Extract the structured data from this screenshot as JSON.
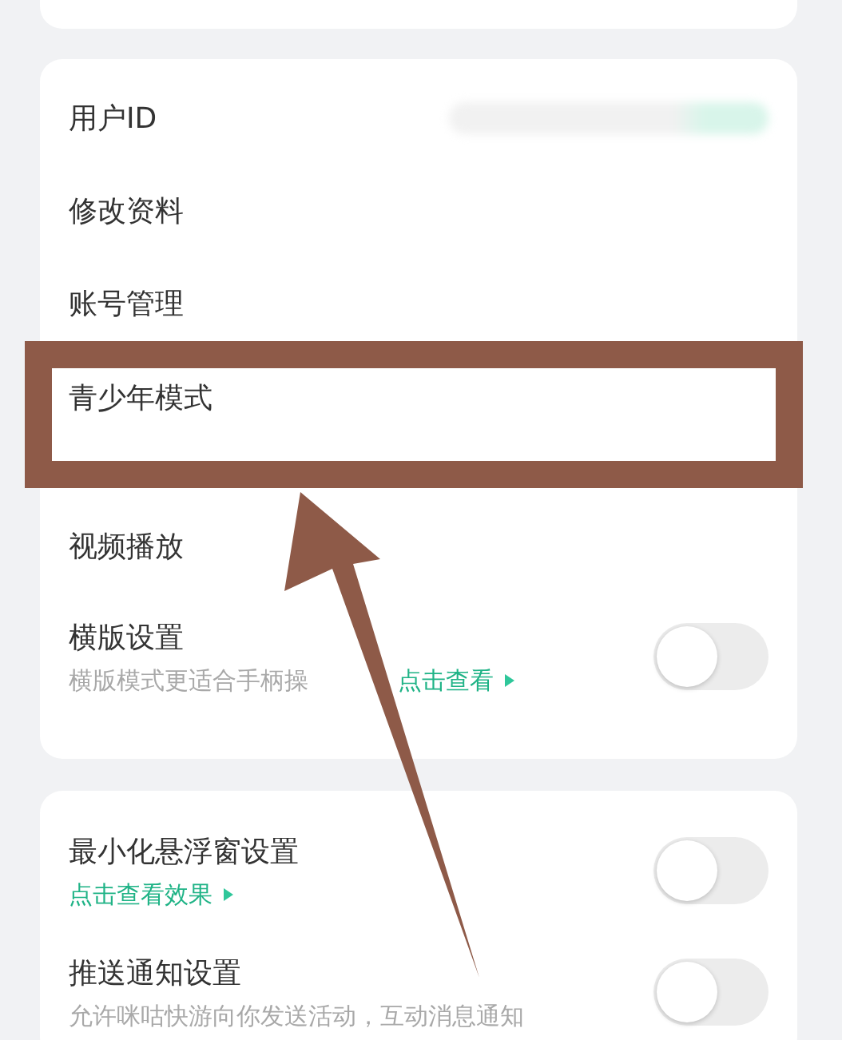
{
  "account_items": [
    {
      "label": "用户ID",
      "kind": "id",
      "highlighted": false
    },
    {
      "label": "修改资料",
      "kind": "link",
      "highlighted": false
    },
    {
      "label": "账号管理",
      "kind": "link",
      "highlighted": false
    },
    {
      "label": "青少年模式",
      "kind": "link",
      "highlighted": true
    },
    {
      "label": "视频播放",
      "kind": "link",
      "highlighted": false
    },
    {
      "label": "横版设置",
      "kind": "toggle",
      "on": false,
      "subtitle": "横版模式更适合手柄操",
      "link": "点击查看"
    }
  ],
  "other_items": [
    {
      "label": "最小化悬浮窗设置",
      "kind": "toggle",
      "on": false,
      "link": "点击查看效果"
    },
    {
      "label": "推送通知设置",
      "kind": "toggle",
      "on": false,
      "subtitle": "允许咪咕快游向你发送活动，互动消息通知"
    }
  ]
}
